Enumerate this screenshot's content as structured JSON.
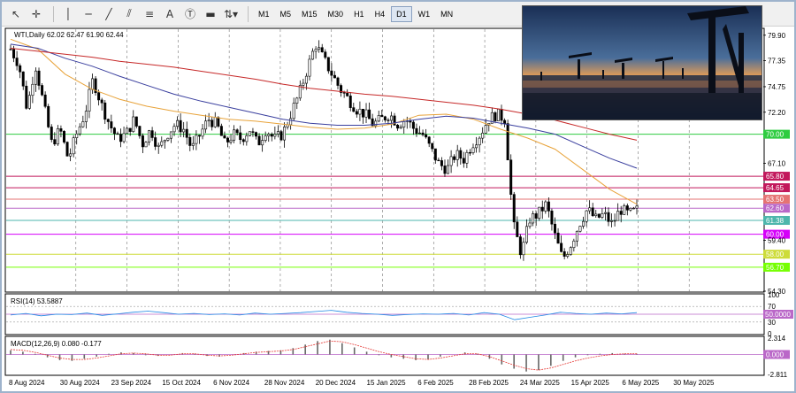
{
  "toolbar": {
    "timeframes": [
      "M1",
      "M5",
      "M15",
      "M30",
      "H1",
      "H4",
      "D1",
      "W1",
      "MN"
    ],
    "active_timeframe": "D1"
  },
  "chart": {
    "header": "WTI,Daily  62.02 62.47 61.90 62.44",
    "price_axis": [
      "79.90",
      "77.35",
      "74.75",
      "72.20",
      "67.10",
      "59.40",
      "54.30"
    ],
    "levels": [
      {
        "label": "70.00",
        "value": 70.0,
        "color": "#2ecc40"
      },
      {
        "label": "64.65",
        "value": 64.65,
        "color": "#c2185b"
      },
      {
        "label": "65.80",
        "value": 65.8,
        "color": "#c2185b"
      },
      {
        "label": "63.50",
        "value": 63.5,
        "color": "#e57373"
      },
      {
        "label": "62.60",
        "value": 62.6,
        "color": "#ba68c8"
      },
      {
        "label": "61.38",
        "value": 61.38,
        "color": "#4db6ac"
      },
      {
        "label": "60.00",
        "value": 60.0,
        "color": "#d500f9"
      },
      {
        "label": "58.00",
        "value": 58.0,
        "color": "#cddc39"
      },
      {
        "label": "56.70",
        "value": 56.7,
        "color": "#76ff03"
      }
    ],
    "date_axis": [
      "8 Aug 2024",
      "30 Aug 2024",
      "23 Sep 2024",
      "15 Oct 2024",
      "6 Nov 2024",
      "28 Nov 2024",
      "20 Dec 2024",
      "15 Jan 2025",
      "6 Feb 2025",
      "28 Feb 2025",
      "24 Mar 2025",
      "15 Apr 2025",
      "6 May 2025",
      "30 May 2025"
    ]
  },
  "rsi": {
    "header": "RSI(14) 53.5887",
    "axis": [
      "100",
      "70",
      "30",
      "0"
    ],
    "level_label": "50.0000"
  },
  "macd": {
    "header": "MACD(12,26,9) 0.080 -0.177",
    "axis": [
      "2.314",
      "-2.811"
    ],
    "level_label": "0.000"
  },
  "chart_data": {
    "type": "candlestick",
    "symbol": "WTI",
    "timeframe": "Daily",
    "ylim": [
      54.3,
      80.5
    ],
    "moving_averages": [
      {
        "color": "#e8a33a",
        "values": [
          79.5,
          78.5,
          76.0,
          74.5,
          73.5,
          72.8,
          72.3,
          71.9,
          71.5,
          71.3,
          71.0,
          70.7,
          70.5,
          70.6,
          71.0,
          71.9,
          72.0,
          71.5,
          70.5,
          69.6,
          68.5,
          66.5,
          64.5,
          63.0
        ]
      },
      {
        "color": "#3a3f9e",
        "values": [
          79.0,
          78.6,
          77.6,
          76.8,
          75.8,
          74.9,
          74.0,
          73.3,
          72.7,
          72.1,
          71.5,
          71.1,
          70.9,
          70.9,
          71.1,
          71.5,
          71.8,
          71.6,
          71.1,
          70.6,
          70.0,
          68.8,
          67.6,
          66.6
        ]
      },
      {
        "color": "#c62828",
        "values": [
          78.6,
          78.3,
          78.0,
          77.7,
          77.3,
          77.0,
          76.7,
          76.3,
          75.9,
          75.5,
          75.0,
          74.6,
          74.3,
          74.0,
          73.8,
          73.5,
          73.2,
          72.9,
          72.5,
          72.0,
          71.4,
          70.7,
          70.0,
          69.4
        ]
      }
    ],
    "close_path": [
      78.5,
      77.0,
      72.5,
      77.0,
      73.0,
      69.0,
      70.5,
      67.5,
      70.0,
      72.0,
      75.5,
      73.0,
      71.0,
      69.5,
      70.0,
      71.5,
      69.0,
      70.5,
      68.5,
      70.0,
      71.0,
      70.5,
      68.5,
      70.0,
      71.5,
      71.0,
      69.0,
      70.0,
      69.5,
      70.5,
      69.0,
      70.5,
      69.5,
      70.0,
      72.0,
      74.0,
      76.5,
      79.0,
      77.5,
      76.0,
      74.5,
      73.5,
      72.5,
      72.0,
      71.0,
      71.5,
      72.0,
      71.0,
      71.5,
      70.5,
      70.0,
      68.5,
      67.0,
      66.5,
      68.0,
      67.5,
      69.0,
      70.0,
      71.5,
      72.0,
      71.5,
      61.0,
      58.0,
      61.5,
      62.0,
      63.0,
      60.0,
      57.5,
      59.0,
      61.0,
      62.5,
      61.5,
      62.0,
      61.0,
      62.5,
      62.0,
      62.4
    ],
    "rsi_values": [
      48,
      52,
      46,
      50,
      49,
      53,
      47,
      51,
      55,
      58,
      54,
      50,
      52,
      49,
      51,
      48,
      53,
      50,
      52,
      54,
      57,
      60,
      55,
      52,
      50,
      47,
      49,
      51,
      50,
      52,
      48,
      54,
      50,
      36,
      42,
      48,
      55,
      52,
      50,
      53,
      51,
      54
    ],
    "macd_hist": [
      0.6,
      0.4,
      0.1,
      -0.4,
      -0.8,
      -0.9,
      -0.6,
      -0.3,
      0.1,
      0.3,
      0.2,
      -0.1,
      -0.2,
      0.0,
      0.2,
      0.1,
      -0.2,
      -0.3,
      0.0,
      0.2,
      0.4,
      0.5,
      0.6,
      0.9,
      1.4,
      1.9,
      2.1,
      1.6,
      1.0,
      0.4,
      -0.1,
      -0.4,
      -0.6,
      -0.8,
      -0.7,
      -0.3,
      0.0,
      0.3,
      0.1,
      -0.6,
      -1.4,
      -2.0,
      -2.4,
      -2.2,
      -1.6,
      -0.9,
      -0.4,
      -0.1,
      0.1,
      0.2,
      0.1,
      0.1
    ],
    "macd_signal": [
      0.7,
      0.6,
      0.3,
      -0.1,
      -0.5,
      -0.7,
      -0.7,
      -0.5,
      -0.2,
      0.1,
      0.2,
      0.1,
      -0.1,
      -0.1,
      0.1,
      0.1,
      -0.1,
      -0.2,
      -0.1,
      0.1,
      0.3,
      0.4,
      0.5,
      0.7,
      1.1,
      1.5,
      1.9,
      1.8,
      1.4,
      0.9,
      0.4,
      0.0,
      -0.3,
      -0.6,
      -0.7,
      -0.5,
      -0.2,
      0.1,
      0.1,
      -0.3,
      -0.9,
      -1.5,
      -2.0,
      -2.2,
      -1.9,
      -1.4,
      -0.9,
      -0.5,
      -0.2,
      0.0,
      0.1,
      0.1
    ]
  }
}
